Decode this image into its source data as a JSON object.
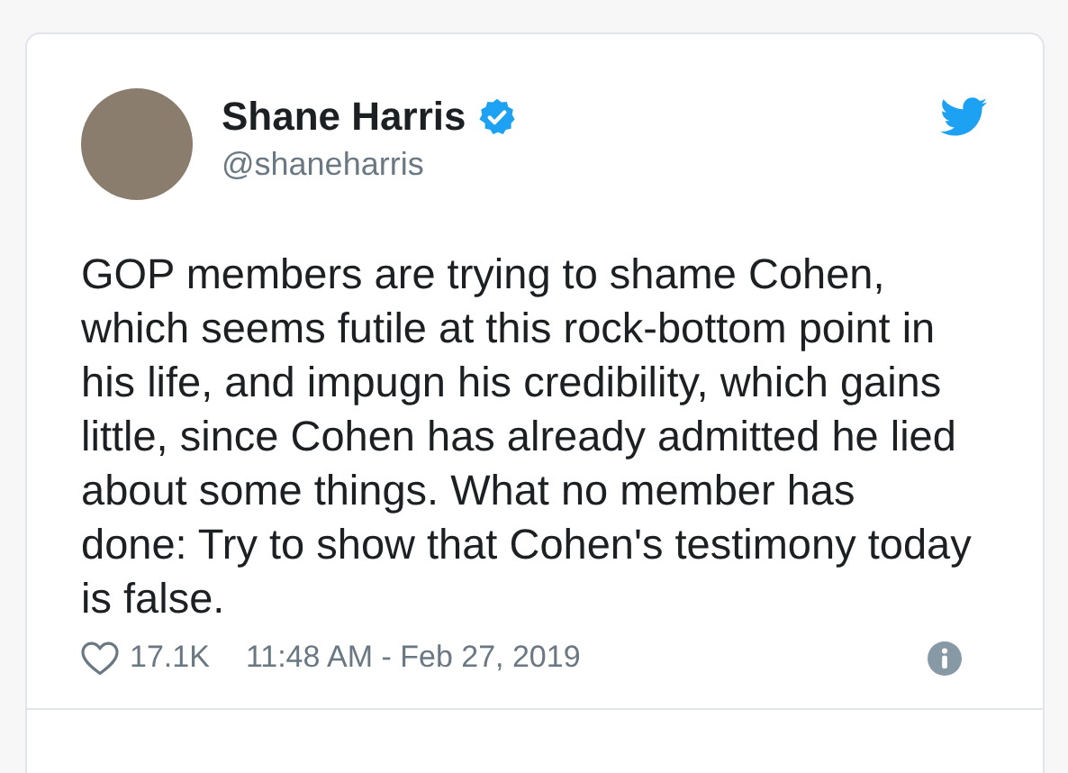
{
  "author": {
    "name": "Shane Harris",
    "verified": true,
    "handle": "@shaneharris"
  },
  "tweet": {
    "text": "GOP members are trying to shame Cohen, which seems futile at this rock-bottom point in his life, and impugn his credibility, which gains little, since Cohen has already admitted he lied about some things. What no member has done: Try to show that Cohen's testimony today is false."
  },
  "footer": {
    "likes": "17.1K",
    "timestamp": "11:48 AM - Feb 27, 2019"
  }
}
